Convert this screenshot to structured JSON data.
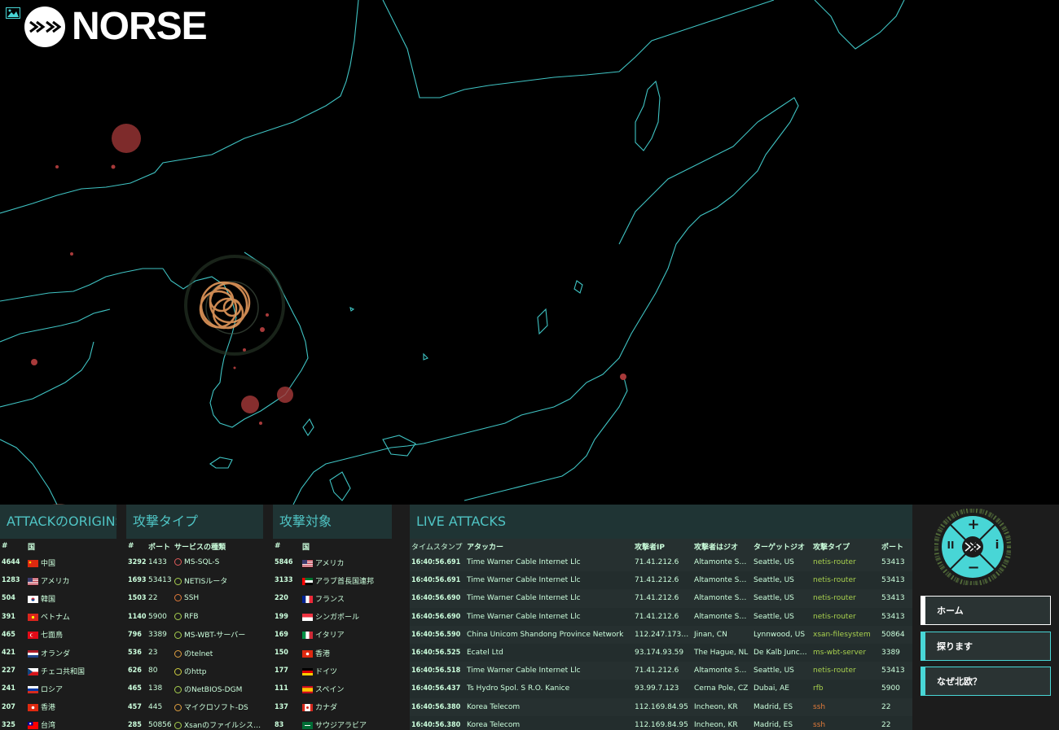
{
  "brand": {
    "name": "NORSE"
  },
  "panels": {
    "origins": {
      "title": "ATTACKのORIGINS",
      "headers": [
        "#",
        "国"
      ],
      "rows": [
        {
          "count": "4644",
          "flag": "cn",
          "name": "中国"
        },
        {
          "count": "1283",
          "flag": "us",
          "name": "アメリカ"
        },
        {
          "count": "504",
          "flag": "kr",
          "name": "韓国"
        },
        {
          "count": "391",
          "flag": "vn",
          "name": "ベトナム"
        },
        {
          "count": "465",
          "flag": "tr",
          "name": "七面鳥"
        },
        {
          "count": "421",
          "flag": "nl",
          "name": "オランダ"
        },
        {
          "count": "227",
          "flag": "cz",
          "name": "チェコ共和国"
        },
        {
          "count": "241",
          "flag": "ru",
          "name": "ロシア"
        },
        {
          "count": "207",
          "flag": "hk",
          "name": "香港"
        },
        {
          "count": "325",
          "flag": "tw",
          "name": "台湾"
        }
      ]
    },
    "types": {
      "title": "攻撃タイプ",
      "headers": [
        "#",
        "ポート",
        "サービスの種類"
      ],
      "rows": [
        {
          "count": "3292",
          "port": "1433",
          "service": "MS-SQL-S",
          "color": "#e05a5a"
        },
        {
          "count": "1693",
          "port": "53413",
          "service": "NETISルータ",
          "color": "#a8d04e"
        },
        {
          "count": "1503",
          "port": "22",
          "service": "SSH",
          "color": "#e07a3a"
        },
        {
          "count": "1140",
          "port": "5900",
          "service": "RFB",
          "color": "#a8d04e"
        },
        {
          "count": "796",
          "port": "3389",
          "service": "MS-WBT-サーバー",
          "color": "#a8d04e"
        },
        {
          "count": "536",
          "port": "23",
          "service": "のtelnet",
          "color": "#e0a040"
        },
        {
          "count": "626",
          "port": "80",
          "service": "のhttp",
          "color": "#d0d040"
        },
        {
          "count": "465",
          "port": "138",
          "service": "のNetBIOS-DGM",
          "color": "#a8d04e"
        },
        {
          "count": "457",
          "port": "445",
          "service": "マイクロソフト-DS",
          "color": "#e0a040"
        },
        {
          "count": "285",
          "port": "50856",
          "service": "Xsanのファイルシステ...",
          "color": "#a8d04e"
        }
      ]
    },
    "targets": {
      "title": "攻撃対象",
      "headers": [
        "#",
        "国"
      ],
      "rows": [
        {
          "count": "5846",
          "flag": "us",
          "name": "アメリカ"
        },
        {
          "count": "3133",
          "flag": "ae",
          "name": "アラブ首長国連邦"
        },
        {
          "count": "220",
          "flag": "fr",
          "name": "フランス"
        },
        {
          "count": "199",
          "flag": "sg",
          "name": "シンガポール"
        },
        {
          "count": "169",
          "flag": "it",
          "name": "イタリア"
        },
        {
          "count": "150",
          "flag": "hk",
          "name": "香港"
        },
        {
          "count": "177",
          "flag": "de",
          "name": "ドイツ"
        },
        {
          "count": "111",
          "flag": "es",
          "name": "スペイン"
        },
        {
          "count": "137",
          "flag": "ca",
          "name": "カナダ"
        },
        {
          "count": "83",
          "flag": "sa",
          "name": "サウジアラビア"
        }
      ]
    },
    "live": {
      "title": "LIVE ATTACKS",
      "headers": [
        "タイムスタンプ",
        "アタッカー",
        "攻撃者IP",
        "攻撃者はジオ",
        "ターゲットジオ",
        "攻撃タイプ",
        "ポート"
      ],
      "rows": [
        {
          "time": "16:40:56.691",
          "attacker": "Time Warner Cable Internet Llc",
          "ip": "71.41.212.6",
          "geo": "Altamonte Spri...",
          "target": "Seattle, US",
          "type": "netis-router",
          "type_color": "#a8d04e",
          "port": "53413"
        },
        {
          "time": "16:40:56.691",
          "attacker": "Time Warner Cable Internet Llc",
          "ip": "71.41.212.6",
          "geo": "Altamonte Spri...",
          "target": "Seattle, US",
          "type": "netis-router",
          "type_color": "#a8d04e",
          "port": "53413"
        },
        {
          "time": "16:40:56.690",
          "attacker": "Time Warner Cable Internet Llc",
          "ip": "71.41.212.6",
          "geo": "Altamonte Spri...",
          "target": "Seattle, US",
          "type": "netis-router",
          "type_color": "#a8d04e",
          "port": "53413"
        },
        {
          "time": "16:40:56.690",
          "attacker": "Time Warner Cable Internet Llc",
          "ip": "71.41.212.6",
          "geo": "Altamonte Spri...",
          "target": "Seattle, US",
          "type": "netis-router",
          "type_color": "#a8d04e",
          "port": "53413"
        },
        {
          "time": "16:40:56.590",
          "attacker": "China Unicom Shandong Province Network",
          "ip": "112.247.173.133",
          "geo": "Jinan, CN",
          "target": "Lynnwood, US",
          "type": "xsan-filesystem",
          "type_color": "#a8d04e",
          "port": "50864"
        },
        {
          "time": "16:40:56.525",
          "attacker": "Ecatel Ltd",
          "ip": "93.174.93.59",
          "geo": "The Hague, NL",
          "target": "De Kalb Junctio...",
          "type": "ms-wbt-server",
          "type_color": "#a8d04e",
          "port": "3389"
        },
        {
          "time": "16:40:56.518",
          "attacker": "Time Warner Cable Internet Llc",
          "ip": "71.41.212.6",
          "geo": "Altamonte Spri...",
          "target": "Seattle, US",
          "type": "netis-router",
          "type_color": "#a8d04e",
          "port": "53413"
        },
        {
          "time": "16:40:56.437",
          "attacker": "Ts Hydro Spol. S R.O. Kanice",
          "ip": "93.99.7.123",
          "geo": "Cerna Pole, CZ",
          "target": "Dubai, AE",
          "type": "rfb",
          "type_color": "#a8d04e",
          "port": "5900"
        },
        {
          "time": "16:40:56.380",
          "attacker": "Korea Telecom",
          "ip": "112.169.84.95",
          "geo": "Incheon, KR",
          "target": "Madrid, ES",
          "type": "ssh",
          "type_color": "#e07a3a",
          "port": "22"
        },
        {
          "time": "16:40:56.380",
          "attacker": "Korea Telecom",
          "ip": "112.169.84.95",
          "geo": "Incheon, KR",
          "target": "Madrid, ES",
          "type": "ssh",
          "type_color": "#e07a3a",
          "port": "22"
        }
      ]
    }
  },
  "controls": {
    "zoom_in": "+",
    "zoom_out": "−",
    "pause": "II",
    "info": "i"
  },
  "nav": {
    "home": "ホーム",
    "explore": "探ります",
    "why": "なぜ北欧？"
  },
  "colors": {
    "accent": "#48d6d6",
    "coast": "#3fc3c3",
    "attack": "#e88a4a"
  }
}
